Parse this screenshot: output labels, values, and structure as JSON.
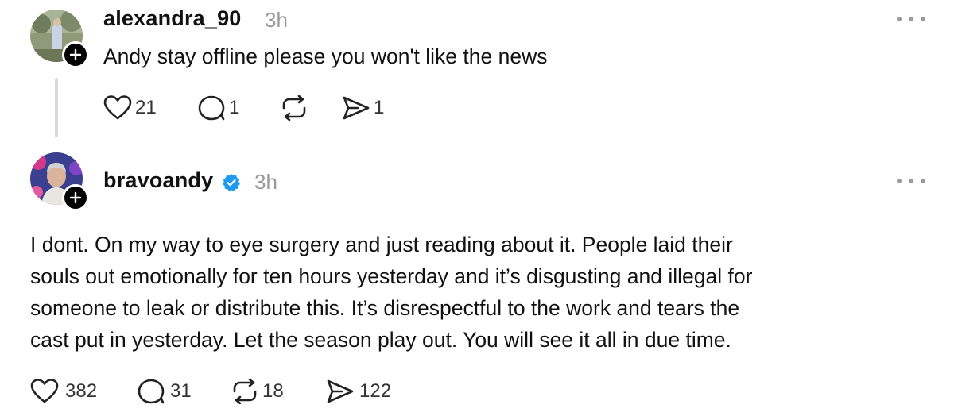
{
  "posts": [
    {
      "username": "alexandra_90",
      "time": "3h",
      "text": "Andy stay offline please you won't like the news",
      "likes": "21",
      "replies": "1",
      "reposts": "",
      "shares": "1"
    },
    {
      "username": "bravoandy",
      "verified": true,
      "time": "3h",
      "text_lines": [
        "I dont. On my way to eye surgery and just reading about it. People laid their",
        "souls out emotionally for ten hours yesterday and it’s disgusting and illegal for",
        "someone to leak or distribute this. It’s disrespectful to the work and tears the",
        "cast put in yesterday. Let the season play out. You will see it all in due time."
      ],
      "likes": "382",
      "replies": "31",
      "reposts": "18",
      "shares": "122"
    }
  ],
  "colors": {
    "text": "#111111",
    "muted": "#9a9a9a",
    "verified": "#1d9bf0",
    "thread_line": "#d9d9d9"
  },
  "icons": {
    "like": "heart-icon",
    "reply": "comment-icon",
    "repost": "repost-icon",
    "share": "send-icon",
    "more": "more-horizontal-icon",
    "follow": "plus-icon",
    "verified": "verified-badge-icon"
  }
}
